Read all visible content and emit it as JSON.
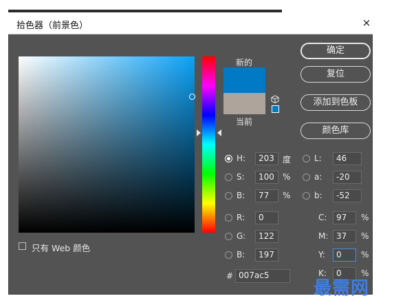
{
  "window": {
    "title": "拾色器（前景色）"
  },
  "swatches": {
    "new_label": "新的",
    "current_label": "当前",
    "new_color": "#007ac5",
    "current_color": "#aea49c"
  },
  "buttons": {
    "ok": "确定",
    "reset": "复位",
    "add_to_swatches": "添加到色板",
    "color_libraries": "颜色库"
  },
  "hsb": {
    "h": {
      "label": "H:",
      "value": "203",
      "unit": "度"
    },
    "s": {
      "label": "S:",
      "value": "100",
      "unit": "%"
    },
    "b": {
      "label": "B:",
      "value": "77",
      "unit": "%"
    }
  },
  "lab": {
    "l": {
      "label": "L:",
      "value": "46"
    },
    "a": {
      "label": "a:",
      "value": "-20"
    },
    "b": {
      "label": "b:",
      "value": "-52"
    }
  },
  "rgb": {
    "r": {
      "label": "R:",
      "value": "0"
    },
    "g": {
      "label": "G:",
      "value": "122"
    },
    "b": {
      "label": "B:",
      "value": "197"
    }
  },
  "cmyk": {
    "c": {
      "label": "C:",
      "value": "97",
      "unit": "%"
    },
    "m": {
      "label": "M:",
      "value": "37",
      "unit": "%"
    },
    "y": {
      "label": "Y:",
      "value": "0",
      "unit": "%"
    },
    "k": {
      "label": "K:",
      "value": "0",
      "unit": "%"
    }
  },
  "hex": {
    "label": "#",
    "value": "007ac5"
  },
  "web_only": {
    "label": "只有 Web 颜色",
    "checked": false
  },
  "selected_mode": "H",
  "watermark": "最需网"
}
